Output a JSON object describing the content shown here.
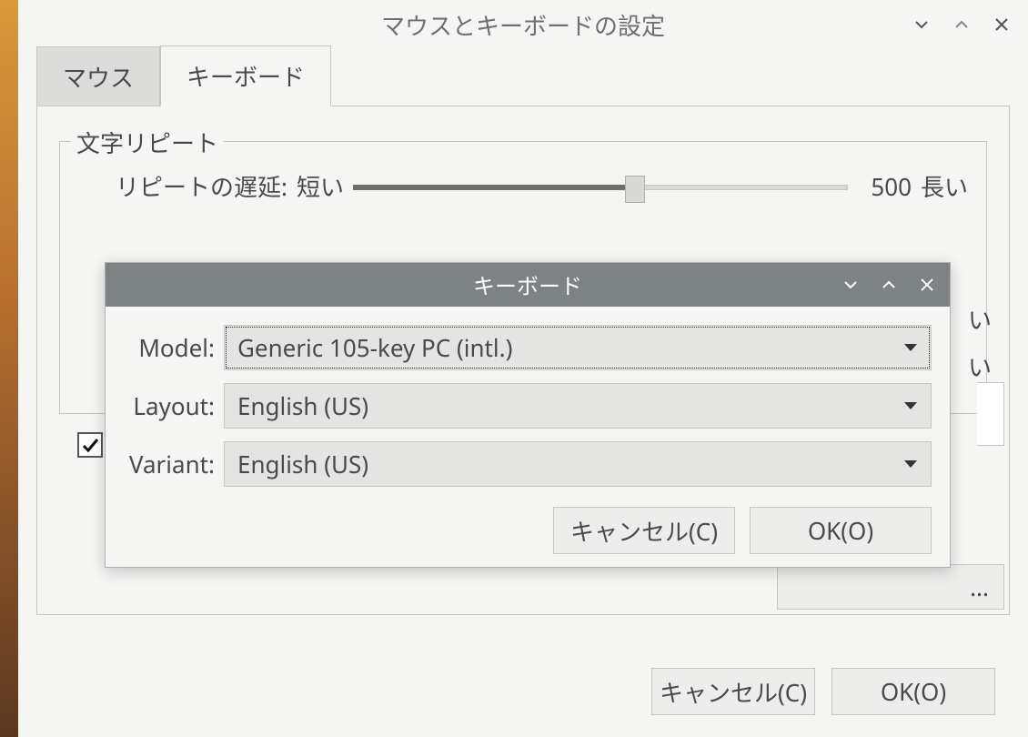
{
  "window": {
    "title": "マウスとキーボードの設定",
    "tabs": {
      "mouse": "マウス",
      "keyboard": "キーボード"
    },
    "group": {
      "title": "文字リピート"
    },
    "repeat_delay": {
      "label": "リピートの遅延:",
      "short": "短い",
      "value": "500",
      "long": "長い",
      "fill_pct": 55
    },
    "peek_long2": "い",
    "peek_long3": "い",
    "partial_btn": "...",
    "buttons": {
      "cancel": "キャンセル(C)",
      "ok": "OK(O)"
    }
  },
  "modal": {
    "title": "キーボード",
    "fields": {
      "model": {
        "label": "Model:",
        "value": "Generic 105-key PC (intl.)"
      },
      "layout": {
        "label": "Layout:",
        "value": "English (US)"
      },
      "variant": {
        "label": "Variant:",
        "value": "English (US)"
      }
    },
    "buttons": {
      "cancel": "キャンセル(C)",
      "ok": "OK(O)"
    }
  }
}
